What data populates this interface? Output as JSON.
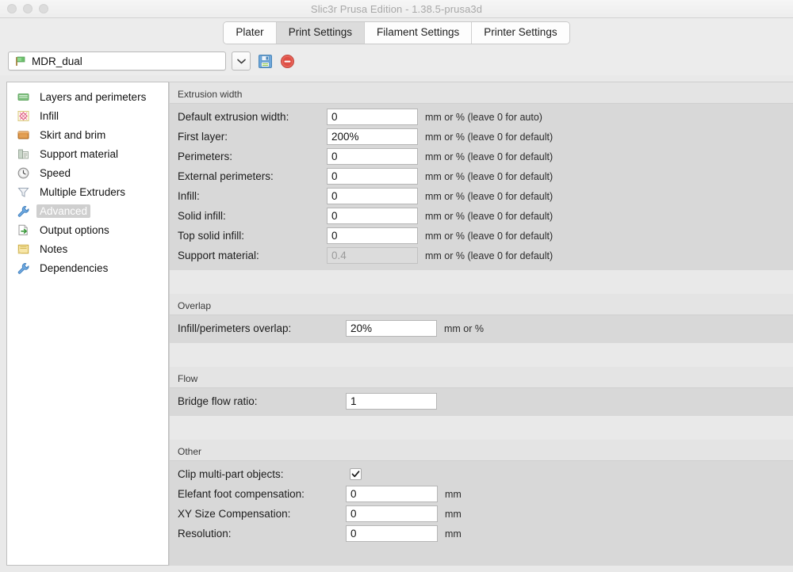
{
  "window": {
    "title": "Slic3r Prusa Edition - 1.38.5-prusa3d",
    "traffic_lights": [
      "close",
      "minimize",
      "zoom"
    ]
  },
  "tabs": [
    {
      "label": "Plater",
      "active": false
    },
    {
      "label": "Print Settings",
      "active": true
    },
    {
      "label": "Filament Settings",
      "active": false
    },
    {
      "label": "Printer Settings",
      "active": false
    }
  ],
  "toolbar": {
    "preset_value": "MDR_dual",
    "preset_icon": "green-flag-icon",
    "dropdown_icon": "chevron-down-icon",
    "save_icon": "floppy-save-icon",
    "delete_icon": "red-delete-icon"
  },
  "sidebar": {
    "items": [
      {
        "label": "Layers and perimeters",
        "icon": "layers-icon",
        "selected": false
      },
      {
        "label": "Infill",
        "icon": "infill-icon",
        "selected": false
      },
      {
        "label": "Skirt and brim",
        "icon": "skirt-brim-icon",
        "selected": false
      },
      {
        "label": "Support material",
        "icon": "support-material-icon",
        "selected": false
      },
      {
        "label": "Speed",
        "icon": "speed-clock-icon",
        "selected": false
      },
      {
        "label": "Multiple Extruders",
        "icon": "funnel-icon",
        "selected": false
      },
      {
        "label": "Advanced",
        "icon": "wrench-icon",
        "selected": true
      },
      {
        "label": "Output options",
        "icon": "output-page-icon",
        "selected": false
      },
      {
        "label": "Notes",
        "icon": "notes-icon",
        "selected": false
      },
      {
        "label": "Dependencies",
        "icon": "wrench-icon",
        "selected": false
      }
    ]
  },
  "groups": [
    {
      "title": "Extrusion width",
      "rows": [
        {
          "label": "Default extrusion width:",
          "value": "0",
          "unit": "mm or % (leave 0 for auto)",
          "disabled": false
        },
        {
          "label": "First layer:",
          "value": "200%",
          "unit": "mm or % (leave 0 for default)",
          "disabled": false
        },
        {
          "label": "Perimeters:",
          "value": "0",
          "unit": "mm or % (leave 0 for default)",
          "disabled": false
        },
        {
          "label": "External perimeters:",
          "value": "0",
          "unit": "mm or % (leave 0 for default)",
          "disabled": false
        },
        {
          "label": "Infill:",
          "value": "0",
          "unit": "mm or % (leave 0 for default)",
          "disabled": false
        },
        {
          "label": "Solid infill:",
          "value": "0",
          "unit": "mm or % (leave 0 for default)",
          "disabled": false
        },
        {
          "label": "Top solid infill:",
          "value": "0",
          "unit": "mm or % (leave 0 for default)",
          "disabled": false
        },
        {
          "label": "Support material:",
          "value": "0.4",
          "unit": "mm or % (leave 0 for default)",
          "disabled": true
        }
      ]
    },
    {
      "title": "Overlap",
      "rows": [
        {
          "label": "Infill/perimeters overlap:",
          "value": "20%",
          "unit": "mm or %",
          "disabled": false
        }
      ]
    },
    {
      "title": "Flow",
      "rows": [
        {
          "label": "Bridge flow ratio:",
          "value": "1",
          "unit": "",
          "disabled": false
        }
      ]
    },
    {
      "title": "Other",
      "rows": [
        {
          "label": "Clip multi-part objects:",
          "type": "checkbox",
          "checked": true,
          "unit": ""
        },
        {
          "label": "Elefant foot compensation:",
          "value": "0",
          "unit": "mm",
          "disabled": false
        },
        {
          "label": "XY Size Compensation:",
          "value": "0",
          "unit": "mm",
          "disabled": false
        },
        {
          "label": "Resolution:",
          "value": "0",
          "unit": "mm",
          "disabled": false
        }
      ]
    }
  ],
  "colors": {
    "window_bg": "#e9e9e9",
    "panel_bg": "#d8d8d8",
    "group_header_bg": "#e4e4e4",
    "selection": "#cfcfcf",
    "save_icon": "#5b9bd5",
    "delete_icon": "#e05a4f"
  }
}
